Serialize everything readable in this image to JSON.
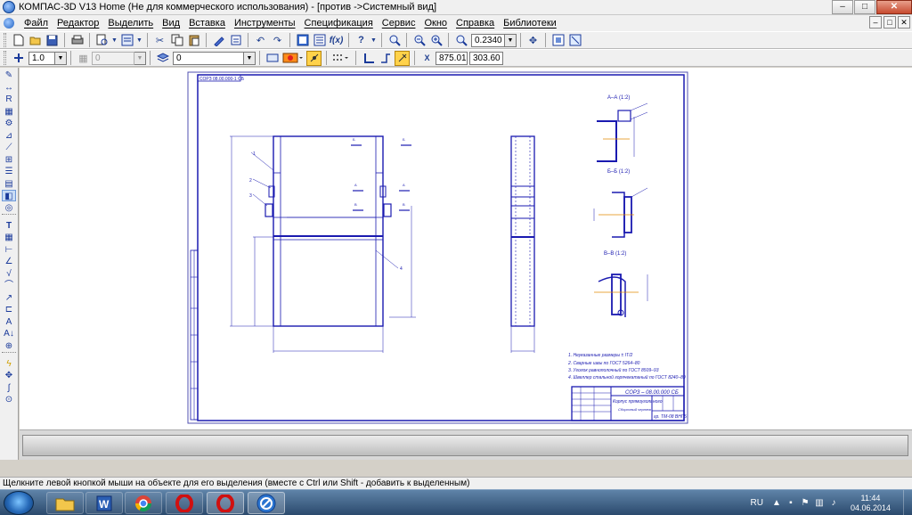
{
  "window": {
    "title": "КОМПАС-3D V13 Home (Не для коммерческого использования) - [против ->Системный вид]",
    "minimize": "–",
    "maximize": "□",
    "close": "✕"
  },
  "menu": {
    "items": [
      "Файл",
      "Редактор",
      "Выделить",
      "Вид",
      "Вставка",
      "Инструменты",
      "Спецификация",
      "Сервис",
      "Окно",
      "Справка",
      "Библиотеки"
    ]
  },
  "toolbar1": {
    "zoom_value": "0.2340"
  },
  "toolbar2": {
    "line_weight": "1.0",
    "style_value": "0",
    "layer_value": "0",
    "coord_x": "875.01",
    "coord_y": "303.60"
  },
  "drawing": {
    "stamp_text": "СОРЗ – 08.00.000 СБ",
    "stamp_name": "Корпус прямоугольного",
    "stamp_sub": "Сборочный чертеж",
    "stamp_org": "гр. ТМ-08 ВНГБ",
    "view_labels": [
      "А–А (1:2)",
      "Б–Б (1:2)",
      "В–В (1:2)"
    ],
    "notes": [
      "1. Неуказанные размеры ± IT/2",
      "2. Сварные швы по ГОСТ 5264–80",
      "3. Уголок равнополочный по ГОСТ 8509–93",
      "4. Швеллер стальной горячекатаный по ГОСТ 8240–89"
    ],
    "top_left_label": "СОРЗ 08.00.000-1 СБ"
  },
  "status": {
    "message": "Щелкните левой кнопкой мыши на объекте для его выделения (вместе с Ctrl или Shift - добавить к выделенным)"
  },
  "taskbar": {
    "language": "RU",
    "time": "11:44",
    "date": "04.06.2014"
  }
}
